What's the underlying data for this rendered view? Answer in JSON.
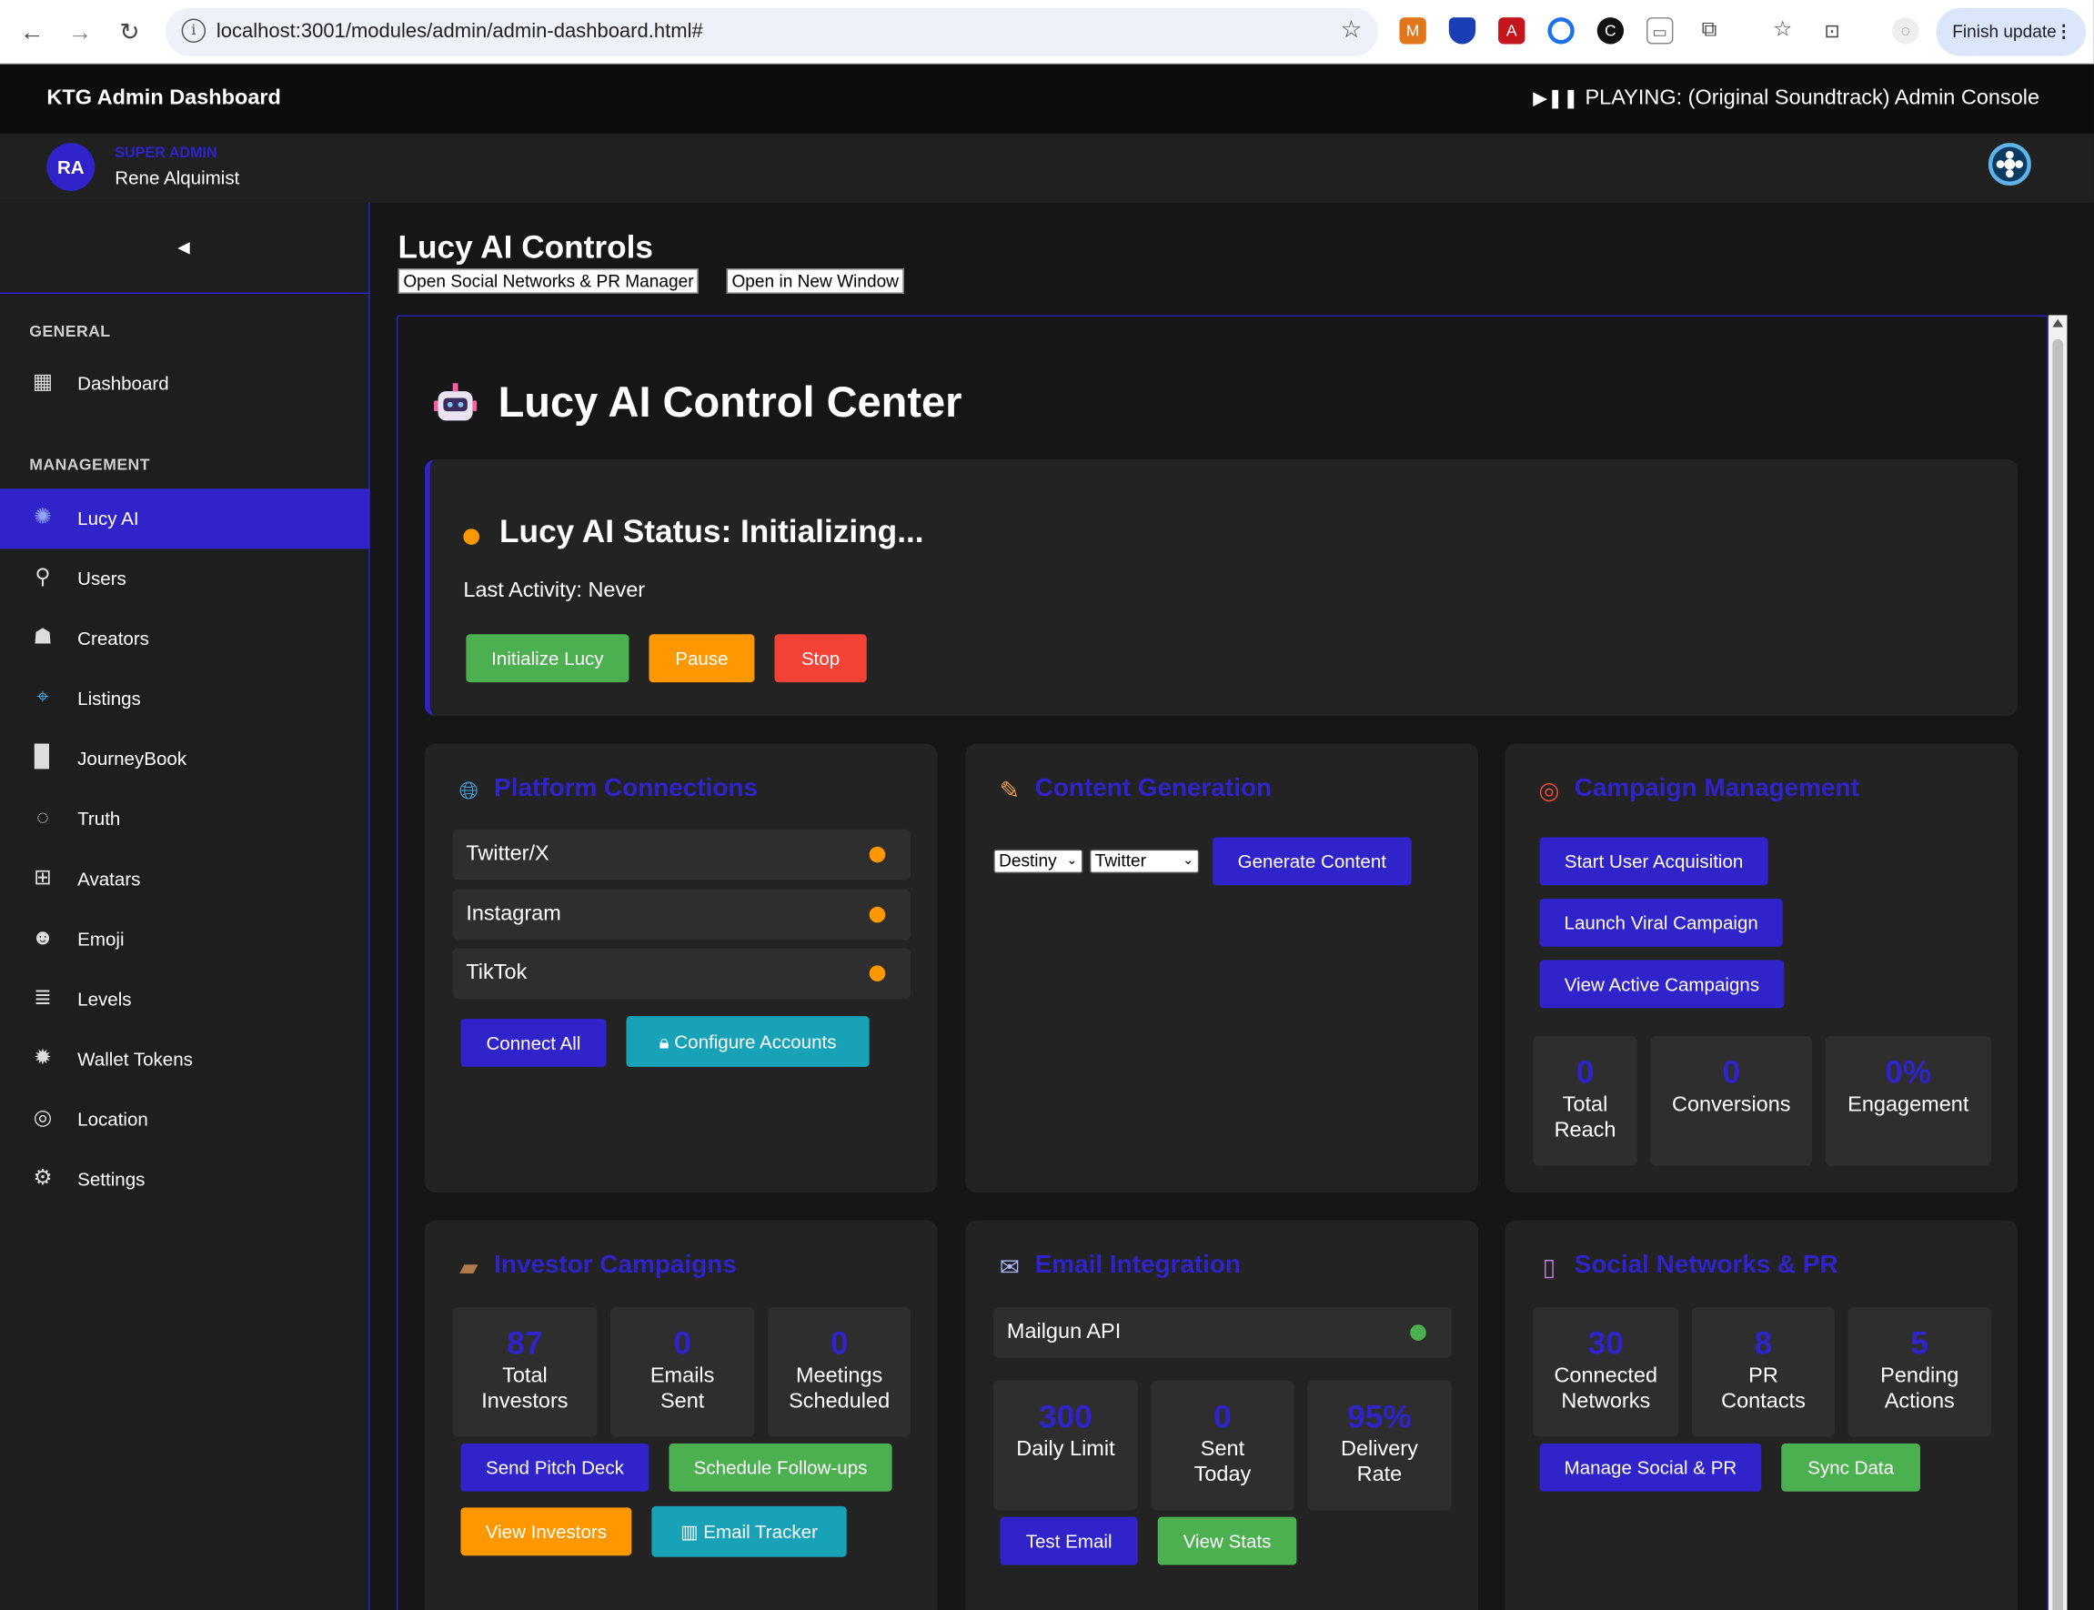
{
  "browser": {
    "url": "localhost:3001/modules/admin/admin-dashboard.html#",
    "finish_update": "Finish update"
  },
  "app": {
    "title": "KTG Admin Dashboard",
    "now_playing": "PLAYING: (Original Soundtrack) Admin Console"
  },
  "user": {
    "initials": "RA",
    "role": "SUPER ADMIN",
    "name": "Rene Alquimist"
  },
  "sidebar": {
    "sections": [
      "GENERAL",
      "MANAGEMENT"
    ],
    "items": [
      {
        "label": "Dashboard",
        "icon": "dashboard-icon"
      },
      {
        "label": "Lucy AI",
        "icon": "sparkle-icon"
      },
      {
        "label": "Users",
        "icon": "user-icon"
      },
      {
        "label": "Creators",
        "icon": "group-icon"
      },
      {
        "label": "Listings",
        "icon": "target-icon"
      },
      {
        "label": "JourneyBook",
        "icon": "book-icon"
      },
      {
        "label": "Truth",
        "icon": "bomb-icon"
      },
      {
        "label": "Avatars",
        "icon": "grid-icon"
      },
      {
        "label": "Emoji",
        "icon": "alien-icon"
      },
      {
        "label": "Levels",
        "icon": "coins-icon"
      },
      {
        "label": "Wallet Tokens",
        "icon": "token-icon"
      },
      {
        "label": "Location",
        "icon": "location-icon"
      },
      {
        "label": "Settings",
        "icon": "gear-icon"
      }
    ]
  },
  "main": {
    "title": "Lucy AI Controls",
    "open_social": "Open Social Networks & PR Manager",
    "open_window": "Open in New Window",
    "control_center": "Lucy AI Control Center",
    "status": {
      "title": "Lucy AI Status: Initializing...",
      "last_activity": "Last Activity: Never",
      "init": "Initialize Lucy",
      "pause": "Pause",
      "stop": "Stop"
    },
    "platforms": {
      "title": "Platform Connections",
      "rows": [
        "Twitter/X",
        "Instagram",
        "TikTok"
      ],
      "connect_all": "Connect All",
      "configure": "Configure Accounts"
    },
    "content": {
      "title": "Content Generation",
      "persona": "Destiny",
      "platform": "Twitter",
      "generate": "Generate Content"
    },
    "campaigns": {
      "title": "Campaign Management",
      "start": "Start User Acquisition",
      "viral": "Launch Viral Campaign",
      "view": "View Active Campaigns",
      "stats": [
        {
          "value": "0",
          "label": "Total Reach"
        },
        {
          "value": "0",
          "label": "Conversions"
        },
        {
          "value": "0%",
          "label": "Engagement"
        }
      ]
    },
    "investors": {
      "title": "Investor Campaigns",
      "stats": [
        {
          "value": "87",
          "label": "Total Investors"
        },
        {
          "value": "0",
          "label": "Emails Sent"
        },
        {
          "value": "0",
          "label": "Meetings Scheduled"
        }
      ],
      "pitch": "Send Pitch Deck",
      "followups": "Schedule Follow-ups",
      "view": "View Investors",
      "tracker": "Email Tracker"
    },
    "email": {
      "title": "Email Integration",
      "api": "Mailgun API",
      "stats": [
        {
          "value": "300",
          "label": "Daily Limit"
        },
        {
          "value": "0",
          "label": "Sent Today"
        },
        {
          "value": "95%",
          "label": "Delivery Rate"
        }
      ],
      "test": "Test Email",
      "view_stats": "View Stats"
    },
    "social": {
      "title": "Social Networks & PR",
      "stats": [
        {
          "value": "30",
          "label": "Connected Networks"
        },
        {
          "value": "8",
          "label": "PR Contacts"
        },
        {
          "value": "5",
          "label": "Pending Actions"
        }
      ],
      "manage": "Manage Social & PR",
      "sync": "Sync Data"
    }
  },
  "colors": {
    "accent": "#2f23c9",
    "status_pending": "#ff9800",
    "status_ok": "#4caf50",
    "danger": "#f44336",
    "teal": "#17a2b8"
  }
}
